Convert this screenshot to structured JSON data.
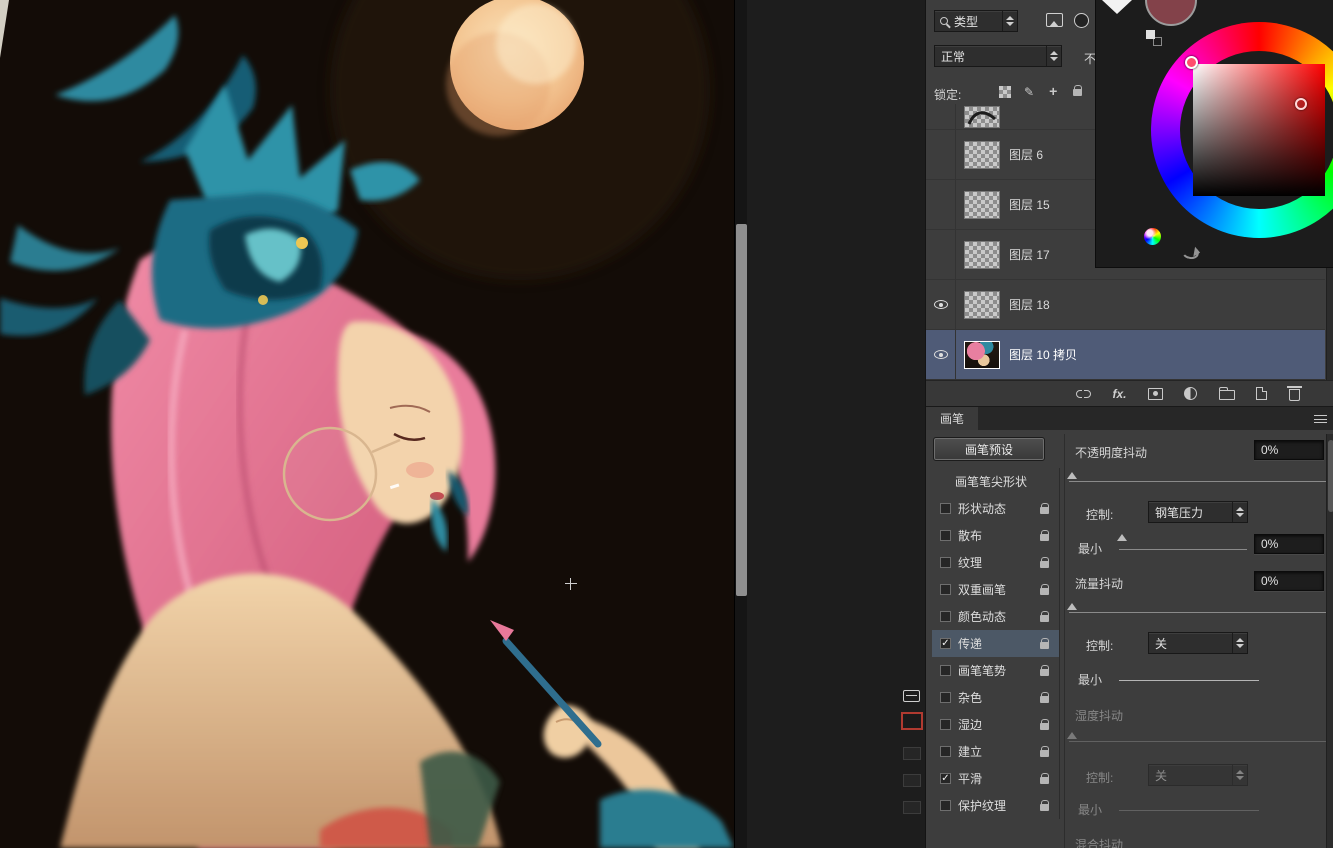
{
  "layers_panel": {
    "filter_row": {
      "type_label": "类型"
    },
    "blend_row": {
      "blend_mode": "正常",
      "opacity_label": "不"
    },
    "lock_row": {
      "label": "锁定:"
    },
    "layers": [
      {
        "name": "",
        "visible": false,
        "selected": false
      },
      {
        "name": "图层 6",
        "visible": false,
        "selected": false
      },
      {
        "name": "图层 15",
        "visible": false,
        "selected": false
      },
      {
        "name": "图层 17",
        "visible": false,
        "selected": false
      },
      {
        "name": "图层 18",
        "visible": true,
        "selected": false
      },
      {
        "name": "图层 10 拷贝",
        "visible": true,
        "selected": true
      }
    ],
    "footer": {
      "fx_label": "fx."
    }
  },
  "color_picker": {
    "current_color": "#83424a",
    "selected_hue": "#ff4d6d",
    "selected_color": "#e03a3a"
  },
  "brush_panel": {
    "tab_label": "画笔",
    "presets_button": "画笔预设",
    "tip_shape": "画笔笔尖形状",
    "options": [
      {
        "label": "形状动态",
        "checked": false
      },
      {
        "label": "散布",
        "checked": false
      },
      {
        "label": "纹理",
        "checked": false
      },
      {
        "label": "双重画笔",
        "checked": false
      },
      {
        "label": "颜色动态",
        "checked": false
      },
      {
        "label": "传递",
        "checked": true
      },
      {
        "label": "画笔笔势",
        "checked": false
      },
      {
        "label": "杂色",
        "checked": false
      },
      {
        "label": "湿边",
        "checked": false
      },
      {
        "label": "建立",
        "checked": false
      },
      {
        "label": "平滑",
        "checked": true
      },
      {
        "label": "保护纹理",
        "checked": false
      }
    ],
    "settings": {
      "opacity_jitter_label": "不透明度抖动",
      "opacity_jitter_value": "0%",
      "control_label_1": "控制:",
      "control_value_1": "钢笔压力",
      "minimum_label_1": "最小",
      "minimum_value_1": "0%",
      "flow_jitter_label": "流量抖动",
      "flow_jitter_value": "0%",
      "control_label_2": "控制:",
      "control_value_2": "关",
      "minimum_label_2": "最小",
      "wetness_jitter_label": "湿度抖动",
      "control_label_3": "控制:",
      "control_value_3": "关",
      "minimum_label_3": "最小",
      "mix_jitter_label": "混合抖动"
    }
  }
}
